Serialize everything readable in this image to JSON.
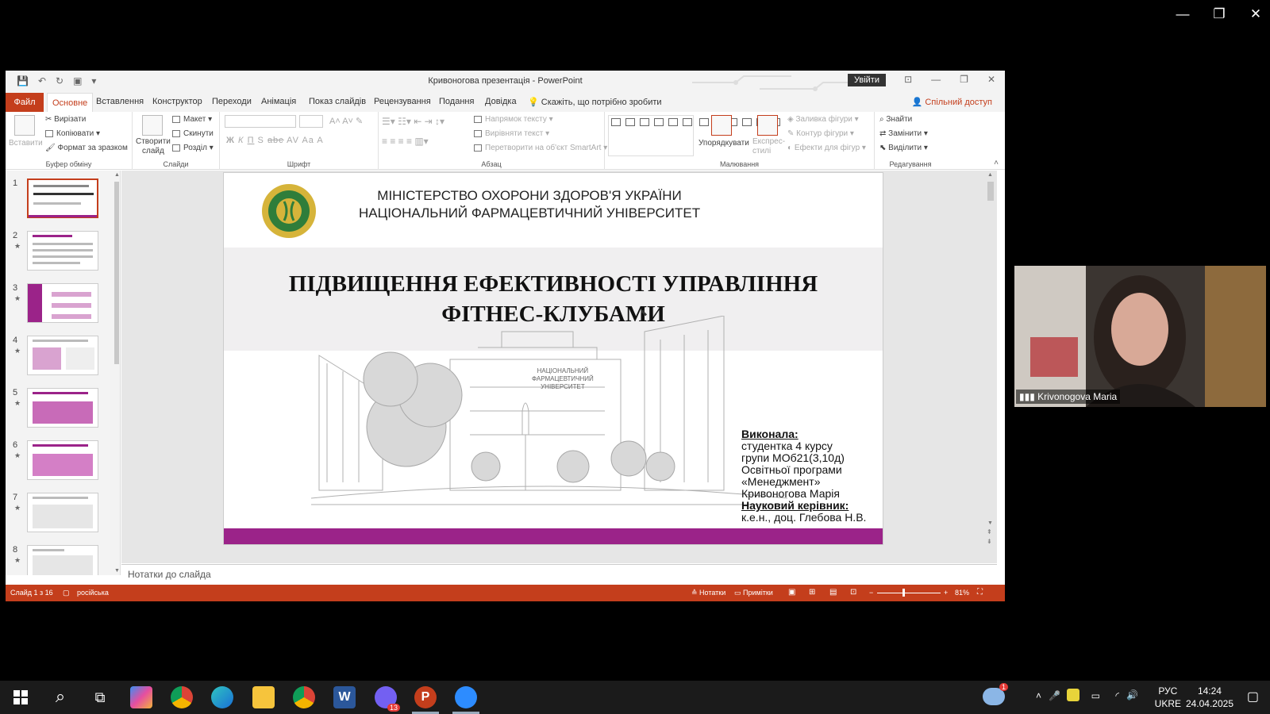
{
  "zoom_window": {
    "minimize": "—",
    "restore": "❐",
    "close": "✕"
  },
  "ppt": {
    "title": "Кривоногова презентація  -  PowerPoint",
    "sign_in": "Увійти",
    "qat": [
      "💾",
      "↶",
      "↻",
      "▣",
      "▾"
    ],
    "window": {
      "minimize": "—",
      "restore": "❐",
      "close": "✕",
      "ribbon_opts": "⊡"
    },
    "tabs": [
      "Файл",
      "Основне",
      "Вставлення",
      "Конструктор",
      "Переходи",
      "Анімація",
      "Показ слайдів",
      "Рецензування",
      "Подання",
      "Довідка"
    ],
    "tell_me": "Скажіть, що потрібно зробити",
    "share": "Спільний доступ",
    "ribbon": {
      "clipboard": {
        "paste": "Вставити",
        "cut": "Вирізати",
        "copy": "Копіювати",
        "format_painter": "Формат за зразком",
        "label": "Буфер обміну"
      },
      "slides": {
        "new_slide_1": "Створити",
        "new_slide_2": "слайд",
        "layout": "Макет",
        "reset": "Скинути",
        "section": "Розділ",
        "label": "Слайди"
      },
      "font": {
        "label": "Шрифт",
        "buttons": [
          "Ж",
          "К",
          "П",
          "S",
          "abc",
          "AV",
          "Aa",
          "A"
        ]
      },
      "paragraph": {
        "text_direction": "Напрямок тексту",
        "align_text": "Вирівняти текст",
        "smartart": "Перетворити на об'єкт SmartArt",
        "label": "Абзац"
      },
      "drawing": {
        "arrange": "Упорядкувати",
        "quick_styles_1": "Експрес-",
        "quick_styles_2": "стилі",
        "fill": "Заливка фігури",
        "outline": "Контур фігури",
        "effects": "Ефекти для фігур",
        "label": "Малювання"
      },
      "editing": {
        "find": "Знайти",
        "replace": "Замінити",
        "select": "Виділити",
        "label": "Редагування"
      }
    },
    "thumbnails": [
      {
        "num": "1",
        "star": ""
      },
      {
        "num": "2",
        "star": "★"
      },
      {
        "num": "3",
        "star": "★"
      },
      {
        "num": "4",
        "star": "★"
      },
      {
        "num": "5",
        "star": "★"
      },
      {
        "num": "6",
        "star": "★"
      },
      {
        "num": "7",
        "star": "★"
      },
      {
        "num": "8",
        "star": "★"
      }
    ],
    "slide": {
      "ministry_line1": "МІНІСТЕРСТВО ОХОРОНИ ЗДОРОВ'Я УКРАЇНИ",
      "ministry_line2": "НАЦІОНАЛЬНИЙ ФАРМАЦЕВТИЧНИЙ УНІВЕРСИТЕТ",
      "title_line1": "ПІДВИЩЕННЯ ЕФЕКТИВНОСТІ УПРАВЛІННЯ",
      "title_line2": "ФІТНЕС-КЛУБАМИ",
      "building_sign_1": "НАЦІОНАЛЬНИЙ",
      "building_sign_2": "ФАРМАЦЕВТИЧНИЙ",
      "building_sign_3": "УНІВЕРСИТЕТ",
      "logo_text_year": "1805",
      "logo_text_bottom": "SAPERE AUDE",
      "logo_text_1921": "1921",
      "info": {
        "done_by": "Виконала:",
        "line1": "студентка 4 курсу",
        "line2": "групи МОб21(3,10д)",
        "line3": "Освітньої програми",
        "line4": "«Менеджмент»",
        "line5": "Кривоногова Марія",
        "supervisor": "Науковий керівник:",
        "line6": "к.е.н., доц. Глебова Н.В."
      }
    },
    "notes_placeholder": "Нотатки до слайда",
    "status": {
      "slide": "Слайд 1 з 16",
      "lang": "російська",
      "notes": "Нотатки",
      "comments": "Примітки",
      "zoom": "81%"
    }
  },
  "camera": {
    "name": "Krivonogova Maria"
  },
  "taskbar": {
    "apps": [
      "start",
      "search",
      "task-view",
      "copilot",
      "chrome",
      "edge",
      "file-explorer",
      "chrome-profile",
      "word",
      "viber",
      "powerpoint",
      "zoom"
    ],
    "viber_badge": "13",
    "weather_badge": "1",
    "lang_top": "РУС",
    "lang_bottom": "UKRE",
    "time": "14:24",
    "date": "24.04.2025",
    "colors": {
      "bar": "#1b1b1b",
      "ppt_accent": "#c43e1c",
      "slide_purple": "#9b2389"
    }
  }
}
